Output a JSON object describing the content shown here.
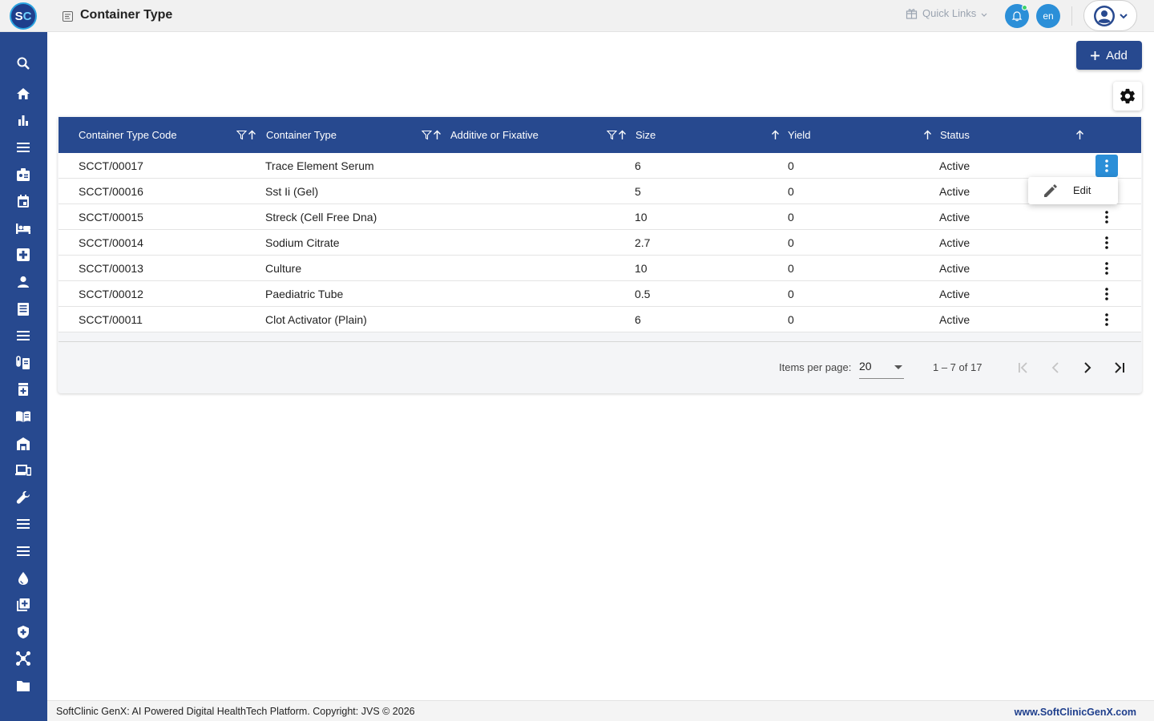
{
  "app": {
    "logo_left": "S",
    "logo_right": "C",
    "page_title": "Container Type",
    "quick_links_label": "Quick Links",
    "language": "en"
  },
  "colors": {
    "brand": "#27498f",
    "accent": "#2b8fd8"
  },
  "sidebar": {
    "items": [
      {
        "icon": "search-icon"
      },
      {
        "icon": "home-icon"
      },
      {
        "icon": "bar-chart-icon"
      },
      {
        "icon": "menu-icon"
      },
      {
        "icon": "id-badge-icon"
      },
      {
        "icon": "calendar-icon"
      },
      {
        "icon": "bed-icon"
      },
      {
        "icon": "medical-cross-icon"
      },
      {
        "icon": "person-icon"
      },
      {
        "icon": "list-document-icon"
      },
      {
        "icon": "menu-icon"
      },
      {
        "icon": "lab-tube-icon"
      },
      {
        "icon": "pill-bottle-icon"
      },
      {
        "icon": "book-icon"
      },
      {
        "icon": "store-icon"
      },
      {
        "icon": "devices-icon"
      },
      {
        "icon": "wrench-icon"
      },
      {
        "icon": "menu-icon"
      },
      {
        "icon": "menu-icon"
      },
      {
        "icon": "blood-drop-icon"
      },
      {
        "icon": "add-library-icon"
      },
      {
        "icon": "shield-icon"
      },
      {
        "icon": "molecule-icon"
      },
      {
        "icon": "folder-icon"
      }
    ]
  },
  "toolbar": {
    "add_label": "Add"
  },
  "table": {
    "columns": [
      {
        "label": "Container Type Code"
      },
      {
        "label": "Container Type"
      },
      {
        "label": "Additive or Fixative"
      },
      {
        "label": "Size"
      },
      {
        "label": "Yield"
      },
      {
        "label": "Status"
      }
    ],
    "rows": [
      {
        "code": "SCCT/00017",
        "type": "Trace Element Serum",
        "additive": "",
        "size": "6",
        "yield": "0",
        "status": "Active"
      },
      {
        "code": "SCCT/00016",
        "type": "Sst Ii (Gel)",
        "additive": "",
        "size": "5",
        "yield": "0",
        "status": "Active"
      },
      {
        "code": "SCCT/00015",
        "type": "Streck (Cell Free Dna)",
        "additive": "",
        "size": "10",
        "yield": "0",
        "status": "Active"
      },
      {
        "code": "SCCT/00014",
        "type": "Sodium Citrate",
        "additive": "",
        "size": "2.7",
        "yield": "0",
        "status": "Active"
      },
      {
        "code": "SCCT/00013",
        "type": "Culture",
        "additive": "",
        "size": "10",
        "yield": "0",
        "status": "Active"
      },
      {
        "code": "SCCT/00012",
        "type": "Paediatric Tube",
        "additive": "",
        "size": "0.5",
        "yield": "0",
        "status": "Active"
      },
      {
        "code": "SCCT/00011",
        "type": "Clot Activator (Plain)",
        "additive": "",
        "size": "6",
        "yield": "0",
        "status": "Active"
      }
    ]
  },
  "row_menu": {
    "edit_label": "Edit"
  },
  "paginator": {
    "items_per_page_label": "Items per page:",
    "items_per_page_value": "20",
    "range_label": "1 – 7 of 17"
  },
  "footer": {
    "left_text": "SoftClinic GenX: AI Powered Digital HealthTech Platform. Copyright: JVS © 2026",
    "right_text": "www.SoftClinicGenX.com"
  }
}
